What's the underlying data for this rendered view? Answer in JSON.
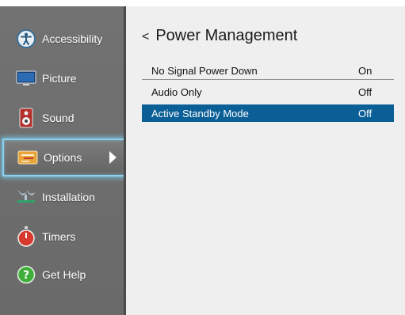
{
  "sidebar": {
    "items": [
      {
        "label": "Accessibility",
        "icon": "accessibility-icon"
      },
      {
        "label": "Picture",
        "icon": "monitor-icon"
      },
      {
        "label": "Sound",
        "icon": "speaker-icon"
      },
      {
        "label": "Options",
        "icon": "options-icon"
      },
      {
        "label": "Installation",
        "icon": "satellite-dish-icon"
      },
      {
        "label": "Timers",
        "icon": "timer-icon"
      },
      {
        "label": "Get Help",
        "icon": "help-icon"
      }
    ],
    "selected_index": 3
  },
  "panel": {
    "back_glyph": "<",
    "title": "Power Management",
    "rows": [
      {
        "name": "No Signal Power Down",
        "value": "On"
      },
      {
        "name": "Audio Only",
        "value": "Off"
      },
      {
        "name": "Active Standby Mode",
        "value": "Off"
      }
    ],
    "highlighted_row": 2
  },
  "colors": {
    "highlight_row": "#0b5f97",
    "selected_glow": "#8ad1ee",
    "sidebar_bg": "#6f6f6f",
    "panel_bg": "#efefef"
  }
}
